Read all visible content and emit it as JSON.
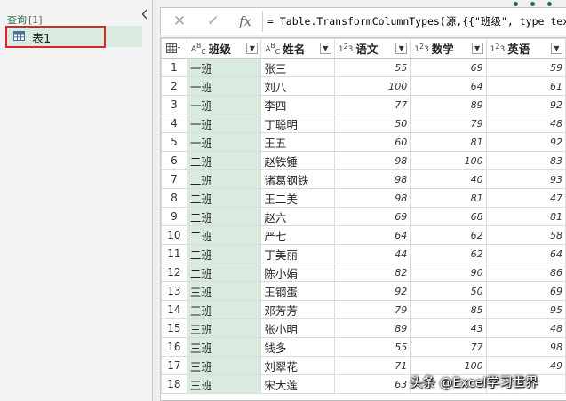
{
  "queries_pane": {
    "header": "查询",
    "count": "[1]",
    "collapse_icon": "chevron-left-icon",
    "items": [
      {
        "name": "表1",
        "icon": "table-icon",
        "selected": true
      }
    ]
  },
  "formula_bar": {
    "cancel_icon": "✕",
    "confirm_icon": "✓",
    "fx_label": "fx",
    "formula": "= Table.TransformColumnTypes(源,{{\"班级\", type text"
  },
  "grid": {
    "columns": [
      {
        "name": "班级",
        "type": "ABC"
      },
      {
        "name": "姓名",
        "type": "ABC"
      },
      {
        "name": "语文",
        "type": "123"
      },
      {
        "name": "数学",
        "type": "123"
      },
      {
        "name": "英语",
        "type": "123"
      }
    ],
    "rows": [
      [
        "1",
        "一班",
        "张三",
        "55",
        "69",
        "59"
      ],
      [
        "2",
        "一班",
        "刘八",
        "100",
        "64",
        "61"
      ],
      [
        "3",
        "一班",
        "李四",
        "77",
        "89",
        "92"
      ],
      [
        "4",
        "一班",
        "丁聪明",
        "50",
        "79",
        "48"
      ],
      [
        "5",
        "一班",
        "王五",
        "60",
        "81",
        "92"
      ],
      [
        "6",
        "二班",
        "赵铁锤",
        "98",
        "100",
        "83"
      ],
      [
        "7",
        "二班",
        "诸葛钢铁",
        "98",
        "40",
        "93"
      ],
      [
        "8",
        "二班",
        "王二美",
        "98",
        "81",
        "47"
      ],
      [
        "9",
        "二班",
        "赵六",
        "69",
        "68",
        "81"
      ],
      [
        "10",
        "二班",
        "严七",
        "64",
        "62",
        "58"
      ],
      [
        "11",
        "二班",
        "丁美丽",
        "44",
        "62",
        "64"
      ],
      [
        "12",
        "二班",
        "陈小娟",
        "82",
        "90",
        "86"
      ],
      [
        "13",
        "三班",
        "王钢蛋",
        "92",
        "50",
        "69"
      ],
      [
        "14",
        "三班",
        "邓芳芳",
        "79",
        "85",
        "95"
      ],
      [
        "15",
        "三班",
        "张小明",
        "89",
        "43",
        "48"
      ],
      [
        "16",
        "三班",
        "钱多",
        "55",
        "77",
        "98"
      ],
      [
        "17",
        "三班",
        "刘翠花",
        "71",
        "100",
        "49"
      ],
      [
        "18",
        "三班",
        "宋大莲",
        "63",
        "",
        ""
      ]
    ]
  },
  "watermark": "头条 @Excel学习世界",
  "colors": {
    "accent": "#217346",
    "selection_border": "#d9262d",
    "text_column_fill": "#d9eadf"
  }
}
